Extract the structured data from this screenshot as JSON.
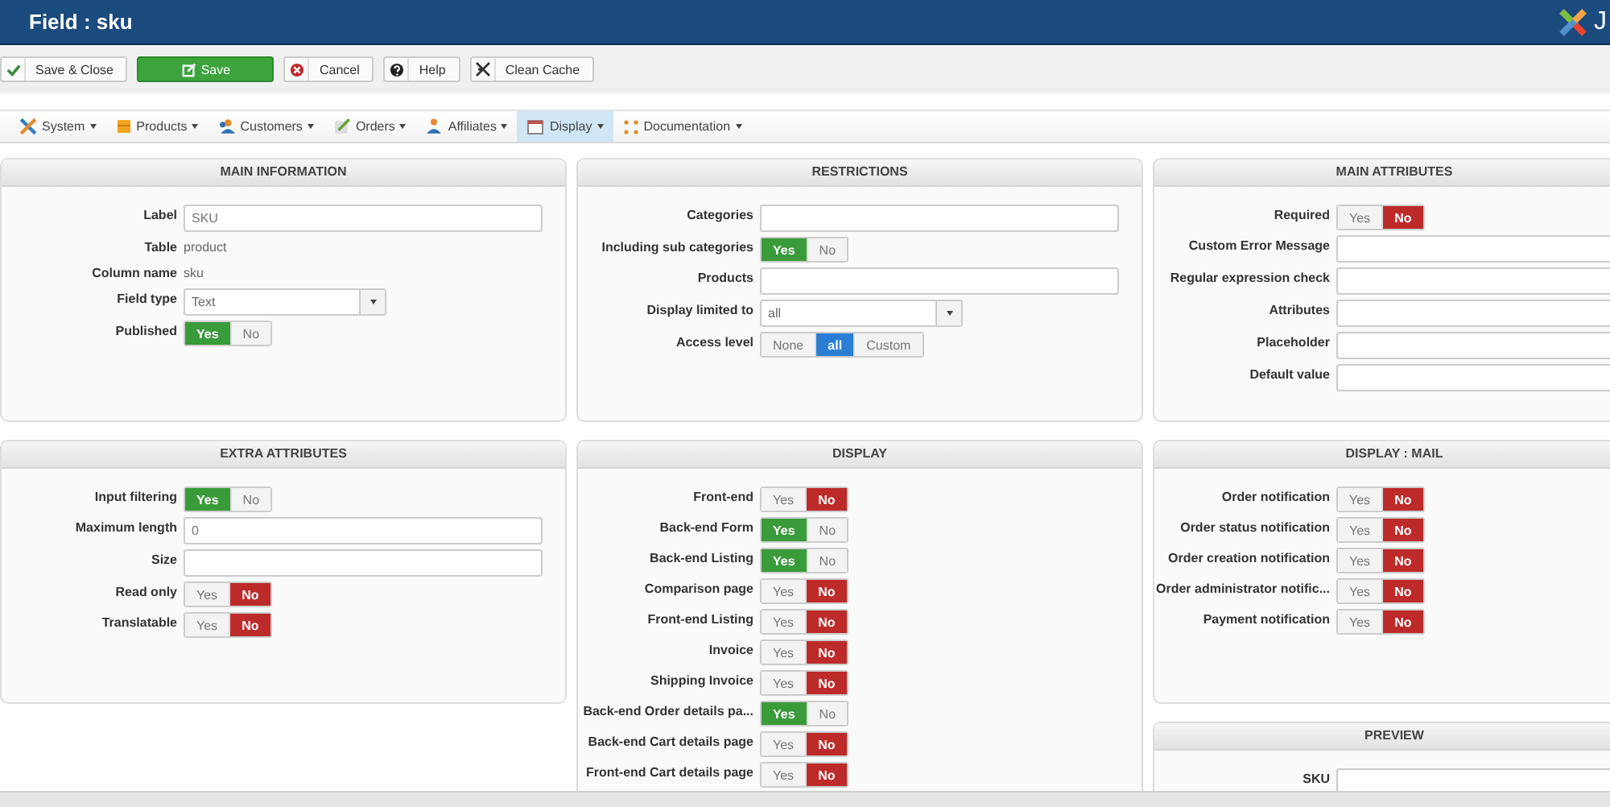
{
  "header": {
    "title": "Field : sku",
    "brand": "J"
  },
  "toolbar": [
    {
      "label": "Save & Close",
      "primary": false
    },
    {
      "label": "Save",
      "primary": true
    },
    {
      "label": "Cancel",
      "primary": false
    },
    {
      "label": "Help",
      "primary": false
    },
    {
      "label": "Clean Cache",
      "primary": false
    }
  ],
  "menu": [
    {
      "label": "System",
      "selected": false
    },
    {
      "label": "Products",
      "selected": false
    },
    {
      "label": "Customers",
      "selected": false
    },
    {
      "label": "Orders",
      "selected": false
    },
    {
      "label": "Affiliates",
      "selected": false
    },
    {
      "label": "Display",
      "selected": true
    },
    {
      "label": "Documentation",
      "selected": false
    }
  ],
  "columns": [
    [
      {
        "title": "MAIN INFORMATION",
        "rows": [
          {
            "kind": "input",
            "label": "Label",
            "value": "SKU"
          },
          {
            "kind": "text",
            "label": "Table",
            "value": "product"
          },
          {
            "kind": "text",
            "label": "Column name",
            "value": "sku"
          },
          {
            "kind": "select",
            "label": "Field type",
            "value": "Text"
          },
          {
            "kind": "toggle",
            "label": "Published",
            "options": [
              {
                "label": "Yes",
                "selected": true,
                "color": "#3a9b3a"
              },
              {
                "label": "No",
                "selected": false
              }
            ]
          }
        ]
      },
      {
        "title": "EXTRA ATTRIBUTES",
        "rows": [
          {
            "kind": "toggle",
            "label": "Input filtering",
            "options": [
              {
                "label": "Yes",
                "selected": true,
                "color": "#3a9b3a"
              },
              {
                "label": "No",
                "selected": false
              }
            ]
          },
          {
            "kind": "input",
            "label": "Maximum length",
            "value": "0"
          },
          {
            "kind": "input",
            "label": "Size"
          },
          {
            "kind": "toggle",
            "label": "Read only",
            "options": [
              {
                "label": "Yes",
                "selected": false
              },
              {
                "label": "No",
                "selected": true,
                "color": "#bd2a2a"
              }
            ]
          },
          {
            "kind": "toggle",
            "label": "Translatable",
            "options": [
              {
                "label": "Yes",
                "selected": false
              },
              {
                "label": "No",
                "selected": true,
                "color": "#bd2a2a"
              }
            ]
          }
        ]
      }
    ],
    [
      {
        "title": "RESTRICTIONS",
        "rows": [
          {
            "kind": "input",
            "label": "Categories"
          },
          {
            "kind": "toggle",
            "label": "Including sub categories",
            "options": [
              {
                "label": "Yes",
                "selected": true,
                "color": "#3a9b3a"
              },
              {
                "label": "No",
                "selected": false
              }
            ]
          },
          {
            "kind": "input",
            "label": "Products"
          },
          {
            "kind": "select",
            "label": "Display limited to",
            "value": "all"
          },
          {
            "kind": "toggle",
            "label": "Access level",
            "options": [
              {
                "label": "None",
                "selected": false
              },
              {
                "label": "all",
                "selected": true,
                "color": "#2a7fd4"
              },
              {
                "label": "Custom",
                "selected": false
              }
            ]
          }
        ]
      },
      {
        "title": "DISPLAY",
        "rows": [
          {
            "kind": "toggle",
            "label": "Front-end",
            "options": [
              {
                "label": "Yes",
                "selected": false
              },
              {
                "label": "No",
                "selected": true,
                "color": "#bd2a2a"
              }
            ]
          },
          {
            "kind": "toggle",
            "label": "Back-end Form",
            "options": [
              {
                "label": "Yes",
                "selected": true,
                "color": "#3a9b3a"
              },
              {
                "label": "No",
                "selected": false
              }
            ]
          },
          {
            "kind": "toggle",
            "label": "Back-end Listing",
            "options": [
              {
                "label": "Yes",
                "selected": true,
                "color": "#3a9b3a"
              },
              {
                "label": "No",
                "selected": false
              }
            ]
          },
          {
            "kind": "toggle",
            "label": "Comparison page",
            "options": [
              {
                "label": "Yes",
                "selected": false
              },
              {
                "label": "No",
                "selected": true,
                "color": "#bd2a2a"
              }
            ]
          },
          {
            "kind": "toggle",
            "label": "Front-end Listing",
            "options": [
              {
                "label": "Yes",
                "selected": false
              },
              {
                "label": "No",
                "selected": true,
                "color": "#bd2a2a"
              }
            ]
          },
          {
            "kind": "toggle",
            "label": "Invoice",
            "options": [
              {
                "label": "Yes",
                "selected": false
              },
              {
                "label": "No",
                "selected": true,
                "color": "#bd2a2a"
              }
            ]
          },
          {
            "kind": "toggle",
            "label": "Shipping Invoice",
            "options": [
              {
                "label": "Yes",
                "selected": false
              },
              {
                "label": "No",
                "selected": true,
                "color": "#bd2a2a"
              }
            ]
          },
          {
            "kind": "toggle",
            "label": "Back-end Order details pa...",
            "options": [
              {
                "label": "Yes",
                "selected": true,
                "color": "#3a9b3a"
              },
              {
                "label": "No",
                "selected": false
              }
            ]
          },
          {
            "kind": "toggle",
            "label": "Back-end Cart details page",
            "options": [
              {
                "label": "Yes",
                "selected": false
              },
              {
                "label": "No",
                "selected": true,
                "color": "#bd2a2a"
              }
            ]
          },
          {
            "kind": "toggle",
            "label": "Front-end Cart details page",
            "options": [
              {
                "label": "Yes",
                "selected": false
              },
              {
                "label": "No",
                "selected": true,
                "color": "#bd2a2a"
              }
            ]
          }
        ]
      }
    ],
    [
      {
        "title": "MAIN ATTRIBUTES",
        "rows": [
          {
            "kind": "toggle",
            "label": "Required",
            "options": [
              {
                "label": "Yes",
                "selected": false
              },
              {
                "label": "No",
                "selected": true,
                "color": "#bd2a2a"
              }
            ]
          },
          {
            "kind": "input",
            "label": "Custom Error Message"
          },
          {
            "kind": "input",
            "label": "Regular expression check"
          },
          {
            "kind": "input",
            "label": "Attributes"
          },
          {
            "kind": "input",
            "label": "Placeholder"
          },
          {
            "kind": "input",
            "label": "Default value"
          }
        ]
      },
      {
        "title": "DISPLAY : MAIL",
        "rows": [
          {
            "kind": "toggle",
            "label": "Order notification",
            "options": [
              {
                "label": "Yes",
                "selected": false
              },
              {
                "label": "No",
                "selected": true,
                "color": "#bd2a2a"
              }
            ]
          },
          {
            "kind": "toggle",
            "label": "Order status notification",
            "options": [
              {
                "label": "Yes",
                "selected": false
              },
              {
                "label": "No",
                "selected": true,
                "color": "#bd2a2a"
              }
            ]
          },
          {
            "kind": "toggle",
            "label": "Order creation notification",
            "options": [
              {
                "label": "Yes",
                "selected": false
              },
              {
                "label": "No",
                "selected": true,
                "color": "#bd2a2a"
              }
            ]
          },
          {
            "kind": "toggle",
            "label": "Order administrator notific...",
            "options": [
              {
                "label": "Yes",
                "selected": false
              },
              {
                "label": "No",
                "selected": true,
                "color": "#bd2a2a"
              }
            ]
          },
          {
            "kind": "toggle",
            "label": "Payment notification",
            "options": [
              {
                "label": "Yes",
                "selected": false
              },
              {
                "label": "No",
                "selected": true,
                "color": "#bd2a2a"
              }
            ]
          }
        ]
      },
      {
        "title": "PREVIEW",
        "rows": [
          {
            "kind": "input",
            "label": "SKU"
          }
        ]
      }
    ]
  ]
}
